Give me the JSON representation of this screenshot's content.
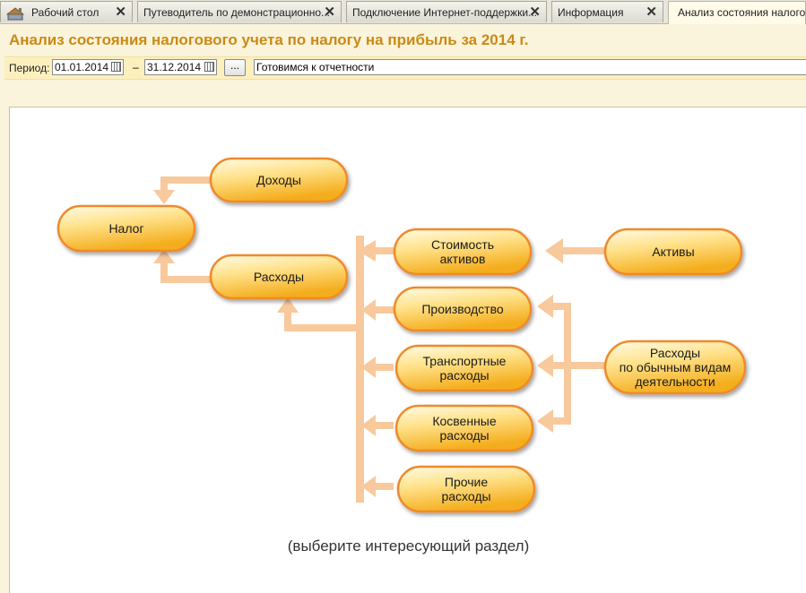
{
  "tabs": [
    {
      "label": "Рабочий стол"
    },
    {
      "label": "Путеводитель по демонстрационно..."
    },
    {
      "label": "Подключение Интернет-поддержки..."
    },
    {
      "label": "Информация"
    },
    {
      "label": "Анализ состояния налогового..."
    }
  ],
  "tab_close_glyph": "✕",
  "header": {
    "title": "Анализ состояния налогового учета по налогу на прибыль за 2014 г."
  },
  "period": {
    "label": "Период:",
    "from": "01.01.2014",
    "separator": "–",
    "to": "31.12.2014",
    "select_button": "...",
    "status": "Готовимся к отчетности"
  },
  "diagram": {
    "nodes": {
      "nalog": [
        "Налог"
      ],
      "dohody": [
        "Доходы"
      ],
      "rashody": [
        "Расходы"
      ],
      "stoimost": [
        "Стоимость",
        "активов"
      ],
      "aktivy": [
        "Активы"
      ],
      "proizvodstvo": [
        "Производство"
      ],
      "transport": [
        "Транспортные",
        "расходы"
      ],
      "kosvennye": [
        "Косвенные",
        "расходы"
      ],
      "prochie": [
        "Прочие",
        "расходы"
      ],
      "obychnye": [
        "Расходы",
        "по обычным видам",
        "деятельности"
      ]
    },
    "hint": "(выберите интересующий раздел)"
  },
  "colors": {
    "accent": "#c98a14",
    "pill_fill_top": "#fff8dc",
    "pill_fill_bottom": "#f5b62a",
    "pill_border": "#ef8a2c",
    "arrow": "#f8c99c"
  },
  "icons": {
    "home": "desktop-icon",
    "calendar": "calendar-icon",
    "close": "close-icon"
  }
}
